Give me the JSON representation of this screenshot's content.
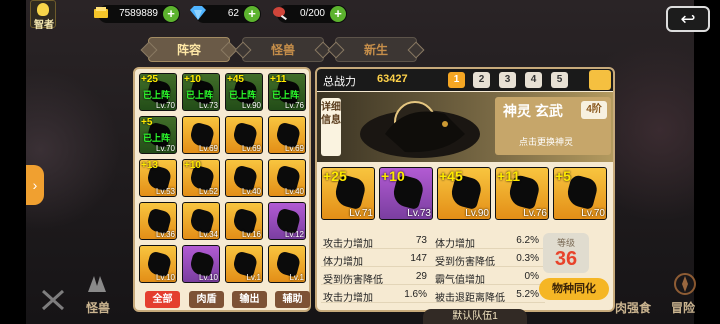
{
  "topbar": {
    "avatar_label": "智者",
    "gold": "7589889",
    "gems": "62",
    "meat": "0/200"
  },
  "tabs": [
    "阵容",
    "怪兽",
    "新生"
  ],
  "roster": {
    "rows": [
      [
        {
          "star": "+25",
          "lv": "Lv.70",
          "deployed": "已上阵",
          "bg": "green"
        },
        {
          "star": "+10",
          "lv": "Lv.73",
          "deployed": "已上阵",
          "bg": "green"
        },
        {
          "star": "+45",
          "lv": "Lv.90",
          "deployed": "已上阵",
          "bg": "green"
        },
        {
          "star": "+11",
          "lv": "Lv.76",
          "deployed": "已上阵",
          "bg": "green"
        }
      ],
      [
        {
          "star": "+5",
          "lv": "Lv.70",
          "deployed": "已上阵",
          "bg": "green"
        },
        {
          "star": "",
          "lv": "Lv.69",
          "deployed": "",
          "bg": "gold"
        },
        {
          "star": "",
          "lv": "Lv.69",
          "deployed": "",
          "bg": "gold"
        },
        {
          "star": "",
          "lv": "Lv.69",
          "deployed": "",
          "bg": "gold"
        }
      ],
      [
        {
          "star": "+13",
          "lv": "Lv.53",
          "deployed": "",
          "bg": "gold"
        },
        {
          "star": "+10",
          "lv": "Lv.52",
          "deployed": "",
          "bg": "gold"
        },
        {
          "star": "",
          "lv": "Lv.40",
          "deployed": "",
          "bg": "gold"
        },
        {
          "star": "",
          "lv": "Lv.40",
          "deployed": "",
          "bg": "gold"
        }
      ],
      [
        {
          "star": "",
          "lv": "Lv.36",
          "deployed": "",
          "bg": "gold"
        },
        {
          "star": "",
          "lv": "Lv.34",
          "deployed": "",
          "bg": "gold"
        },
        {
          "star": "",
          "lv": "Lv.16",
          "deployed": "",
          "bg": "gold"
        },
        {
          "star": "",
          "lv": "Lv.12",
          "deployed": "",
          "bg": "purple"
        }
      ],
      [
        {
          "star": "",
          "lv": "Lv.10",
          "deployed": "",
          "bg": "gold"
        },
        {
          "star": "",
          "lv": "Lv.10",
          "deployed": "",
          "bg": "purple"
        },
        {
          "star": "",
          "lv": "Lv.1",
          "deployed": "",
          "bg": "gold"
        },
        {
          "star": "",
          "lv": "Lv.1",
          "deployed": "",
          "bg": "gold"
        }
      ]
    ],
    "filters": [
      "全部",
      "肉盾",
      "输出",
      "辅助"
    ]
  },
  "team": {
    "power_label": "总战力",
    "power_value": "63427",
    "team_tabs": [
      "1",
      "2",
      "3",
      "4",
      "5"
    ],
    "detail_tag": "详细信息",
    "divine_name": "神灵 玄武",
    "divine_tier": "4阶",
    "divine_hint": "点击更换神灵",
    "deck": [
      {
        "star": "+25",
        "lv": "Lv.71",
        "bg": "gold"
      },
      {
        "star": "+10",
        "lv": "Lv.73",
        "bg": "purple"
      },
      {
        "star": "+45",
        "lv": "Lv.90",
        "bg": "gold"
      },
      {
        "star": "+11",
        "lv": "Lv.76",
        "bg": "gold"
      },
      {
        "star": "+5",
        "lv": "Lv.70",
        "bg": "gold"
      }
    ],
    "stats": [
      {
        "k": "攻击力增加",
        "v": "73"
      },
      {
        "k": "体力增加",
        "v": "6.2%"
      },
      {
        "k": "体力增加",
        "v": "147"
      },
      {
        "k": "受到伤害降低",
        "v": "0.3%"
      },
      {
        "k": "受到伤害降低",
        "v": "29"
      },
      {
        "k": "霸气值增加",
        "v": "0%"
      },
      {
        "k": "攻击力增加",
        "v": "1.6%"
      },
      {
        "k": "被击退距离降低",
        "v": "5.2%"
      }
    ],
    "level_label": "等级",
    "level_value": "36",
    "assimilate_label": "物种同化",
    "default_team": "默认队伍1"
  },
  "bottom_nav": [
    "怪兽",
    "肉强食",
    "冒险"
  ],
  "colors": {
    "panel": "#f6ead2",
    "accent": "#f5a623",
    "deployed": "#2dff2d"
  }
}
